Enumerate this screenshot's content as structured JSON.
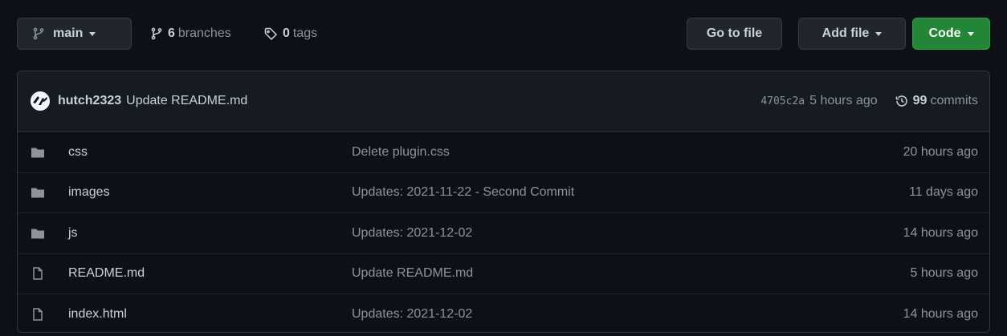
{
  "toolbar": {
    "branch_label": "main",
    "branches_count": "6",
    "branches_label": "branches",
    "tags_count": "0",
    "tags_label": "tags",
    "go_to_file_label": "Go to file",
    "add_file_label": "Add file",
    "code_label": "Code",
    "code_color": "#238636"
  },
  "latest_commit": {
    "user": "hutch2323",
    "message": "Update README.md",
    "sha": "4705c2a",
    "time": "5 hours ago",
    "commits_count": "99",
    "commits_label": "commits"
  },
  "files": [
    {
      "type": "folder-icon",
      "name": "css",
      "message": "Delete plugin.css",
      "time": "20 hours ago"
    },
    {
      "type": "folder-icon",
      "name": "images",
      "message": "Updates: 2021-11-22 - Second Commit",
      "time": "11 days ago"
    },
    {
      "type": "folder-icon",
      "name": "js",
      "message": "Updates: 2021-12-02",
      "time": "14 hours ago"
    },
    {
      "type": "file-icon",
      "name": "README.md",
      "message": "Update README.md",
      "time": "5 hours ago"
    },
    {
      "type": "file-icon",
      "name": "index.html",
      "message": "Updates: 2021-12-02",
      "time": "14 hours ago"
    }
  ]
}
